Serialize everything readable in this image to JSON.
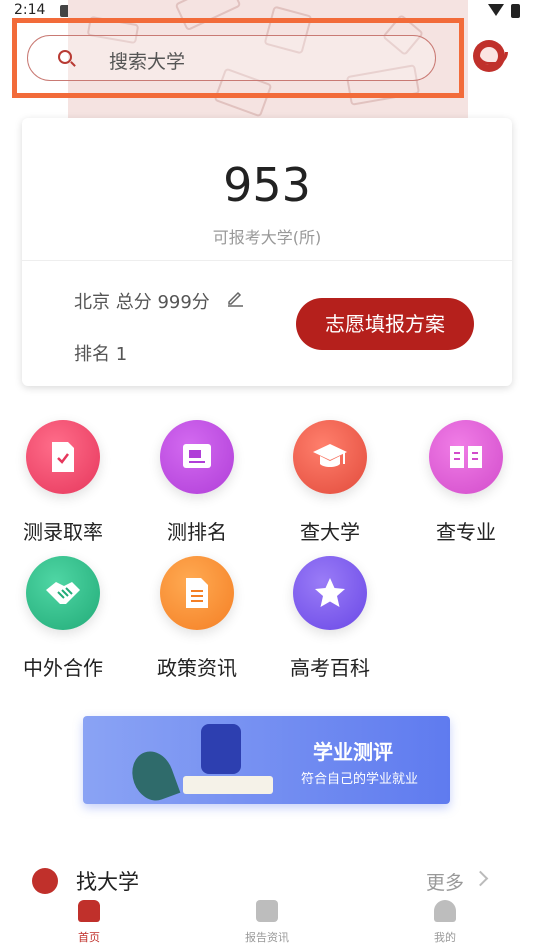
{
  "status_bar": {
    "time": "2:14"
  },
  "search": {
    "placeholder": "搜索大学"
  },
  "score_card": {
    "count": "953",
    "count_caption": "可报考大学(所)",
    "region_score": "北京 总分 999分",
    "rank": "排名 1",
    "plan_button": "志愿填报方案"
  },
  "functions": [
    {
      "label": "测录取率",
      "icon": "document-check-icon",
      "color": "#f04a6a"
    },
    {
      "label": "测排名",
      "icon": "rank-card-icon",
      "color": "#c045e6"
    },
    {
      "label": "查大学",
      "icon": "graduation-cap-icon",
      "color": "#f0614f"
    },
    {
      "label": "查专业",
      "icon": "open-book-icon",
      "color": "#e160d8"
    },
    {
      "label": "中外合作",
      "icon": "handshake-icon",
      "color": "#2fc08a"
    },
    {
      "label": "政策资讯",
      "icon": "policy-doc-icon",
      "color": "#f78b2f"
    },
    {
      "label": "高考百科",
      "icon": "star-icon",
      "color": "#7b5cf0"
    }
  ],
  "banner": {
    "title": "学业测评",
    "subtitle": "符合自己的学业就业"
  },
  "find_university": {
    "title": "找大学",
    "more": "更多"
  },
  "bottom_nav": {
    "items": [
      {
        "label": "首页",
        "active": true,
        "color": "#c0302b"
      },
      {
        "label": "报告资讯",
        "active": false,
        "color": "#999999"
      },
      {
        "label": "我的",
        "active": false,
        "color": "#999999"
      }
    ]
  }
}
